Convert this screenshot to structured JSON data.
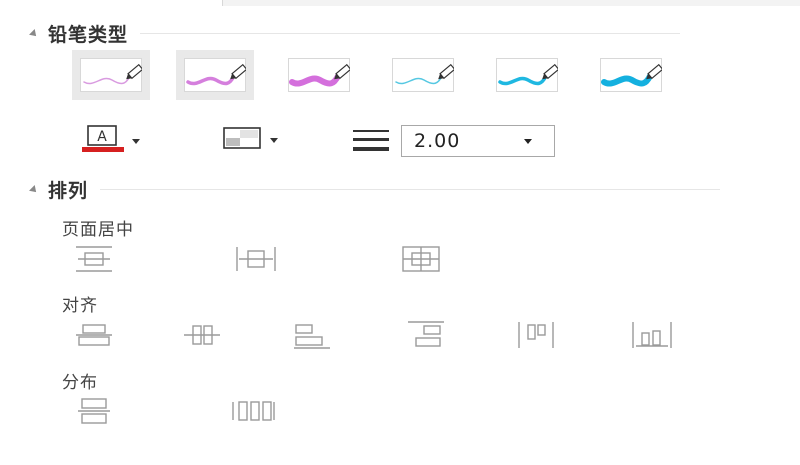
{
  "pencil_section": {
    "title": "铅笔类型",
    "styles": [
      {
        "name": "thin-pink",
        "color": "#d99be0",
        "selected": true
      },
      {
        "name": "medium-pink",
        "color": "#d57fdd",
        "selected": true
      },
      {
        "name": "thick-pink",
        "color": "#d46fdc",
        "selected": false
      },
      {
        "name": "thin-cyan",
        "color": "#56c8e2",
        "selected": false
      },
      {
        "name": "medium-cyan",
        "color": "#1fb8e1",
        "selected": false
      },
      {
        "name": "thick-cyan",
        "color": "#14b0df",
        "selected": false
      }
    ],
    "text_color_icon": "font-color-icon",
    "text_color_bar": "#d62020",
    "fill_icon": "fill-style-icon",
    "line_width_icon": "line-width-icon",
    "line_width_value": "2.00"
  },
  "arrange_section": {
    "title": "排列",
    "page_center": {
      "label": "页面居中",
      "icons": [
        "center-vertical-icon",
        "center-horizontal-icon",
        "center-both-icon"
      ]
    },
    "align": {
      "label": "对齐",
      "icons": [
        "align-center-vertical-icon",
        "align-middle-horizontal-icon",
        "align-left-icon",
        "align-right-icon",
        "align-top-icon",
        "align-bottom-icon"
      ]
    },
    "distribute": {
      "label": "分布",
      "icons": [
        "distribute-vertical-icon",
        "distribute-horizontal-icon"
      ]
    }
  }
}
